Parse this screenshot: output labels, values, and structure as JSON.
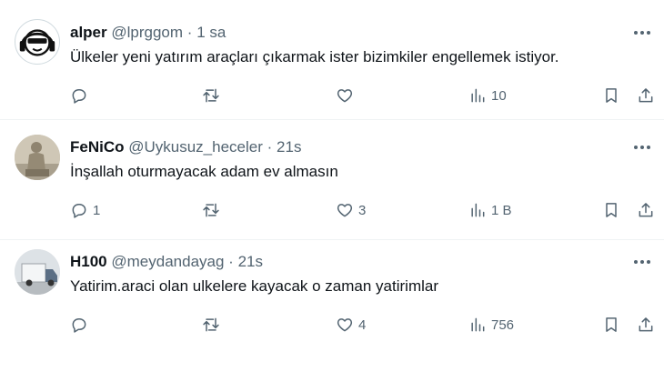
{
  "tweets": [
    {
      "name": "alper",
      "handle": "@lprggom",
      "time": "1 sa",
      "text": "Ülkeler yeni yatırım araçları çıkarmak ister bizimkiler engellemek istiyor.",
      "replies": "",
      "retweets": "",
      "likes": "",
      "views": "10"
    },
    {
      "name": "FeNiCo",
      "handle": "@Uykusuz_heceler",
      "time": "21s",
      "text": "İnşallah oturmayacak adam ev almasın",
      "replies": "1",
      "retweets": "",
      "likes": "3",
      "views": "1 B"
    },
    {
      "name": "H100",
      "handle": "@meydandayag",
      "time": "21s",
      "text": "Yatirim.araci olan ulkelere kayacak o zaman yatirimlar",
      "replies": "",
      "retweets": "",
      "likes": "4",
      "views": "756"
    }
  ],
  "separator": "·",
  "icons": {
    "reply": "reply-icon",
    "retweet": "retweet-icon",
    "like": "heart-icon",
    "views": "views-icon",
    "bookmark": "bookmark-icon",
    "share": "share-icon",
    "more": "more-icon"
  },
  "colors": {
    "text": "#0f1419",
    "muted": "#536471",
    "divider": "#eff3f4",
    "background": "#ffffff"
  }
}
